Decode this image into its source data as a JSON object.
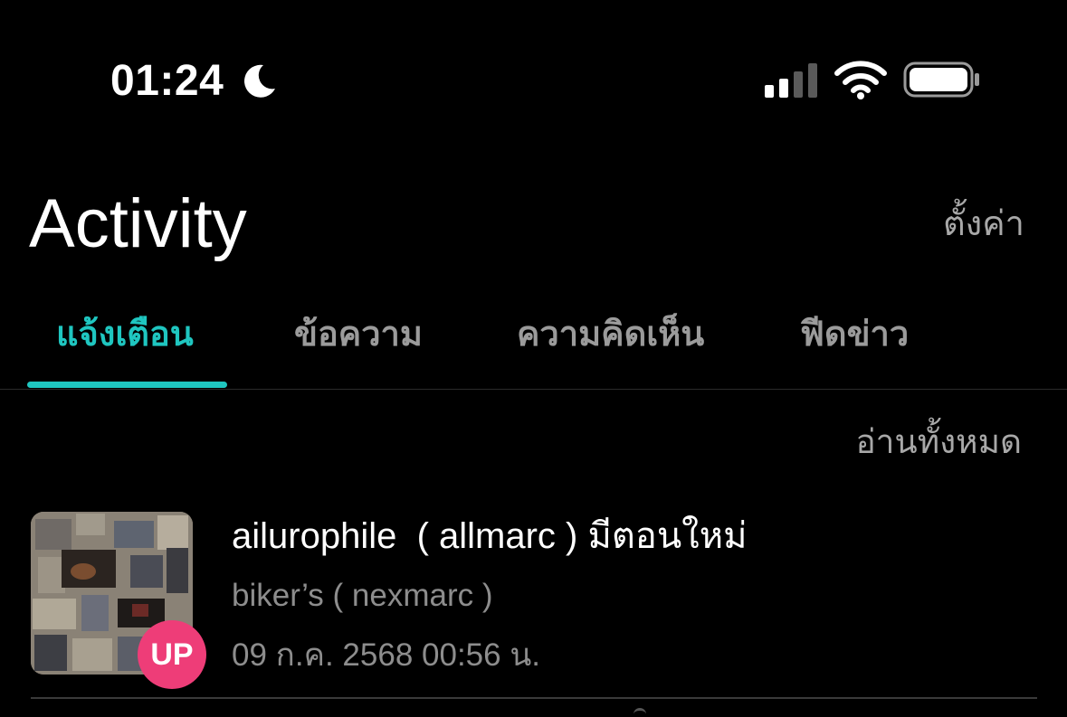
{
  "status_bar": {
    "time": "01:24",
    "focus_icon": "moon-icon",
    "signal_icon": "cellular-signal-icon",
    "wifi_icon": "wifi-icon",
    "battery_icon": "battery-icon"
  },
  "header": {
    "title": "Activity",
    "settings_label": "ตั้งค่า"
  },
  "tabs": [
    {
      "label": "แจ้งเตือน",
      "active": true
    },
    {
      "label": "ข้อความ",
      "active": false
    },
    {
      "label": "ความคิดเห็น",
      "active": false
    },
    {
      "label": "ฟีดข่าว",
      "active": false
    }
  ],
  "actions": {
    "mark_all_read": "อ่านทั้งหมด"
  },
  "notifications": [
    {
      "badge": "UP",
      "title": "ailurophile  ( allmarc ) มีตอนใหม่",
      "subtitle": "biker’s ( nexmarc )",
      "time": "09 ก.ค. 2568 00:56 น."
    }
  ],
  "colors": {
    "accent": "#1fc6c0",
    "badge": "#ee3d78",
    "background": "#000000",
    "muted_text": "#8d8d8d"
  }
}
